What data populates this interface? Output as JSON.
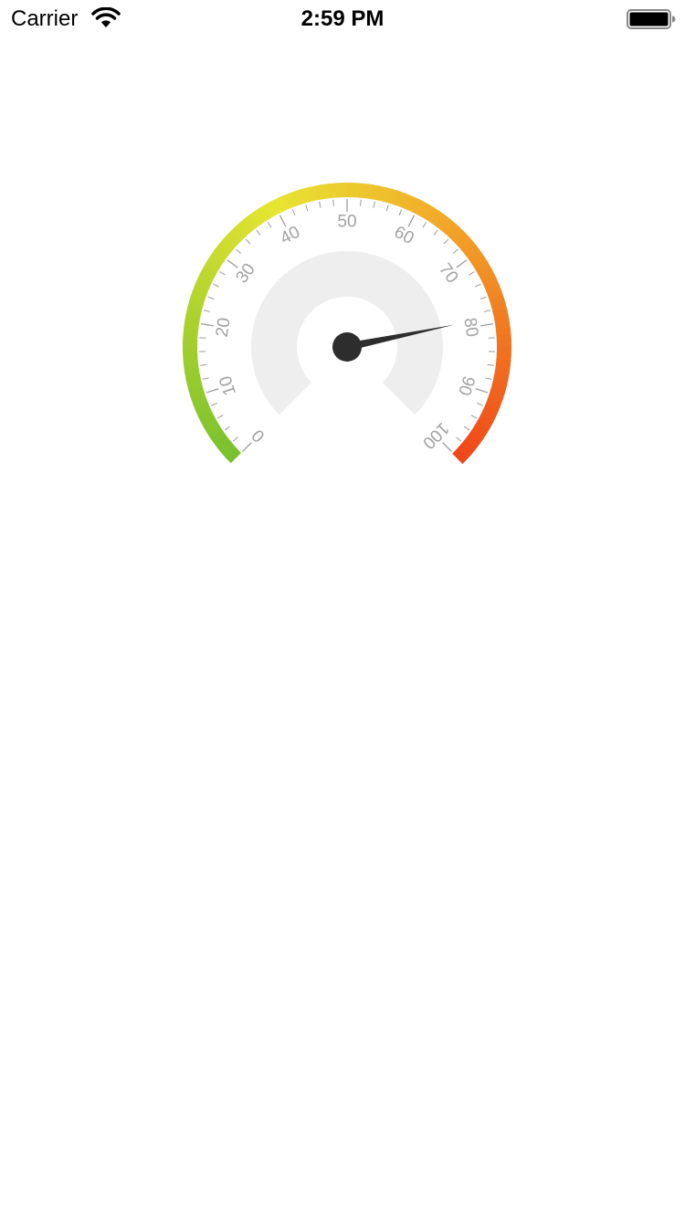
{
  "status_bar": {
    "carrier": "Carrier",
    "time": "2:59 PM",
    "wifi_icon": "wifi-icon",
    "battery_icon": "battery-icon",
    "battery_level": 1.0
  },
  "gauge": {
    "min": 0,
    "max": 100,
    "value": 79,
    "start_angle_deg": 225,
    "end_angle_deg": -45,
    "major_tick_interval": 10,
    "minor_ticks_per_major": 5,
    "tick_labels": [
      "0",
      "10",
      "20",
      "30",
      "40",
      "50",
      "60",
      "70",
      "80",
      "90",
      "100"
    ],
    "colors": {
      "gradient": [
        "#77c12f",
        "#a9d12e",
        "#e7e532",
        "#f1b22b",
        "#f07c22",
        "#f0461a"
      ],
      "band": "#eeeeee",
      "needle": "#2d2d2d",
      "tick": "#9a9a9a",
      "label": "#a2a2a2"
    }
  }
}
